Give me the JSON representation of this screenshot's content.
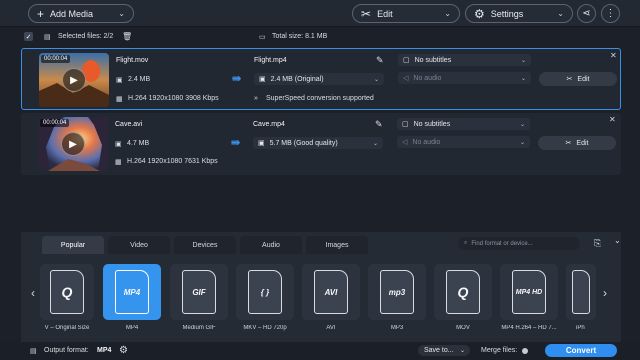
{
  "toolbar": {
    "add_media_label": "Add Media",
    "edit_label": "Edit",
    "settings_label": "Settings"
  },
  "selection": {
    "selected_label": "Selected files: 2/2",
    "total_size_label": "Total size: 8.1 MB"
  },
  "files": [
    {
      "duration": "00:00:04",
      "source_name": "Flight.mov",
      "source_size": "2.4 MB",
      "source_info": "H.264 1920x1080 3908 Kbps",
      "output_name": "Flight.mp4",
      "output_size": "2.4 MB (Original)",
      "subtitles": "No subtitles",
      "audio": "No audio",
      "superspeed": "SuperSpeed conversion supported",
      "edit_label": "Edit"
    },
    {
      "duration": "00:00:04",
      "source_name": "Cave.avi",
      "source_size": "4.7 MB",
      "source_info": "H.264 1920x1080 7631 Kbps",
      "output_name": "Cave.mp4",
      "output_size": "5.7 MB (Good quality)",
      "subtitles": "No subtitles",
      "audio": "No audio",
      "edit_label": "Edit"
    }
  ],
  "tabs": [
    "Popular",
    "Video",
    "Devices",
    "Audio",
    "Images"
  ],
  "search": {
    "placeholder": "Find format or device..."
  },
  "formats": [
    {
      "badge": "",
      "label": "V – Original Size"
    },
    {
      "badge": "MP4",
      "label": "MP4"
    },
    {
      "badge": "GIF",
      "label": "Medium GIF"
    },
    {
      "badge": "{ }",
      "label": "MKV – HD 720p"
    },
    {
      "badge": "AVI",
      "label": "AVI"
    },
    {
      "badge": "mp3",
      "label": "MP3"
    },
    {
      "badge": "Q",
      "label": "MOV"
    },
    {
      "badge": "MP4 HD",
      "label": "MP4 H.264 – HD 7..."
    },
    {
      "badge": "",
      "label": "iPh"
    }
  ],
  "status": {
    "output_format_label": "Output format:",
    "output_format_value": "MP4",
    "save_to_label": "Save to...",
    "merge_files_label": "Merge files:",
    "convert_label": "Convert"
  },
  "colors": {
    "accent": "#2f8ef0",
    "background": "#1c2129"
  }
}
